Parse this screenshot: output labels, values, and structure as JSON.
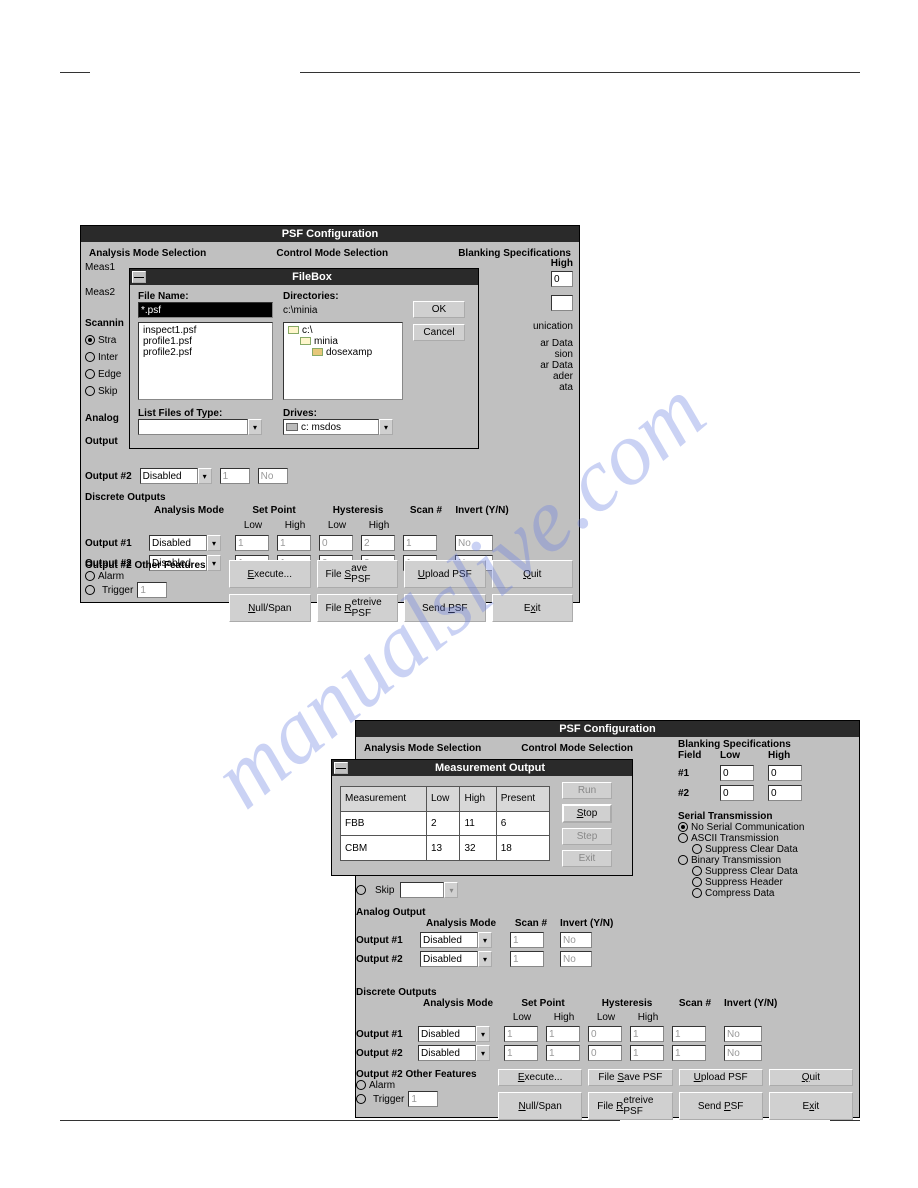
{
  "watermark": "manualslive.com",
  "shot1": {
    "psf_title": "PSF Configuration",
    "filebox": {
      "title": "FileBox",
      "filename_label": "File Name:",
      "filename_value": "*.psf",
      "dirs_label": "Directories:",
      "dirs_path": "c:\\minia",
      "ok": "OK",
      "cancel": "Cancel",
      "files": [
        "inspect1.psf",
        "profile1.psf",
        "profile2.psf"
      ],
      "tree": {
        "root": "c:\\",
        "sub1": "minia",
        "sub2": "dosexamp"
      },
      "listtype_label": "List Files of Type:",
      "drives_label": "Drives:",
      "drive_value": "c: msdos"
    },
    "headers": {
      "analysis_mode": "Analysis Mode Selection",
      "control_mode": "Control Mode Selection",
      "blanking": "Blanking Specifications",
      "high": "High"
    },
    "left_labels": {
      "meas1": "Meas1",
      "meas2": "Meas2",
      "scanning": "Scannin"
    },
    "scan_radios": [
      "Stra",
      "Inter",
      "Edge",
      "Skip"
    ],
    "analog_l": "Analog",
    "output_l": "Output",
    "right_frag": [
      "unication",
      "ar Data",
      "sion",
      "ar Data",
      "ader",
      "ata"
    ],
    "outputs": {
      "out2_label": "Output #2",
      "out1_label": "Output #1",
      "disabled": "Disabled",
      "val1": "1",
      "valNo": "No"
    },
    "discrete_h": "Discrete Outputs",
    "cols": {
      "analysis": "Analysis Mode",
      "setpoint": "Set Point",
      "low": "Low",
      "high": "High",
      "hyst": "Hysteresis",
      "scan": "Scan #",
      "invert": "Invert (Y/N)"
    },
    "dvals": {
      "low": "1",
      "high": "1",
      "hlow": "0",
      "hhigh": "2",
      "scan": "1",
      "inv": "No"
    },
    "other_h": "Output #2 Other Features",
    "other_radio": {
      "alarm": "Alarm",
      "trigger": "Trigger"
    },
    "trigger_val": "1",
    "buttons": {
      "execute": "Execute...",
      "filesave": "File Save PSF",
      "upload": "Upload PSF",
      "quit": "Quit",
      "nullspan": "Null/Span",
      "fileretr": "File Retreive PSF",
      "send": "Send PSF",
      "exit": "Exit"
    }
  },
  "shot2": {
    "psf_title": "PSF Configuration",
    "top_frag": {
      "analysis": "Analysis Mode Selection",
      "control": "Control Mode Selection"
    },
    "blanking": {
      "title": "Blanking Specifications",
      "field": "Field",
      "low": "Low",
      "high": "High",
      "r1": "#1",
      "r1l": "0",
      "r1h": "0",
      "r2": "#2",
      "r2l": "0",
      "r2h": "0"
    },
    "serial": {
      "title": "Serial Transmission",
      "none": "No Serial Communication",
      "ascii": "ASCII Transmission",
      "suppress": "Suppress Clear Data",
      "binary": "Binary Transmission",
      "suppress2": "Suppress Clear Data",
      "header": "Suppress Header",
      "compress": "Compress Data"
    },
    "measure": {
      "title": "Measurement Output",
      "btn_run": "Run",
      "btn_stop": "Stop",
      "btn_step": "Step",
      "btn_exit": "Exit",
      "cols": {
        "m": "Measurement",
        "l": "Low",
        "h": "High",
        "p": "Present"
      },
      "rows": [
        {
          "m": "FBB",
          "l": "2",
          "h": "11",
          "p": "6"
        },
        {
          "m": "CBM",
          "l": "13",
          "h": "32",
          "p": "18"
        }
      ]
    },
    "skip": "Skip",
    "analog_out": "Analog Output",
    "outputs": {
      "o1": "Output #1",
      "o2": "Output #2",
      "analysis": "Analysis Mode",
      "scan": "Scan #",
      "invert": "Invert (Y/N)",
      "disabled": "Disabled",
      "val1": "1",
      "no": "No"
    },
    "discrete_h": "Discrete Outputs",
    "cols": {
      "analysis": "Analysis Mode",
      "setpoint": "Set Point",
      "low": "Low",
      "high": "High",
      "hyst": "Hysteresis",
      "scan": "Scan #",
      "invert": "Invert (Y/N)"
    },
    "dvals": {
      "low": "1",
      "high": "1",
      "hlow": "0",
      "hhigh": "1",
      "scan": "1",
      "inv": "No"
    },
    "other_h": "Output #2 Other Features",
    "other_radio": {
      "alarm": "Alarm",
      "trigger": "Trigger"
    },
    "trigger_val": "1",
    "buttons": {
      "execute": "Execute...",
      "filesave": "File Save PSF",
      "upload": "Upload PSF",
      "quit": "Quit",
      "nullspan": "Null/Span",
      "fileretr": "File Retreive PSF",
      "send": "Send PSF",
      "exit": "Exit"
    }
  }
}
